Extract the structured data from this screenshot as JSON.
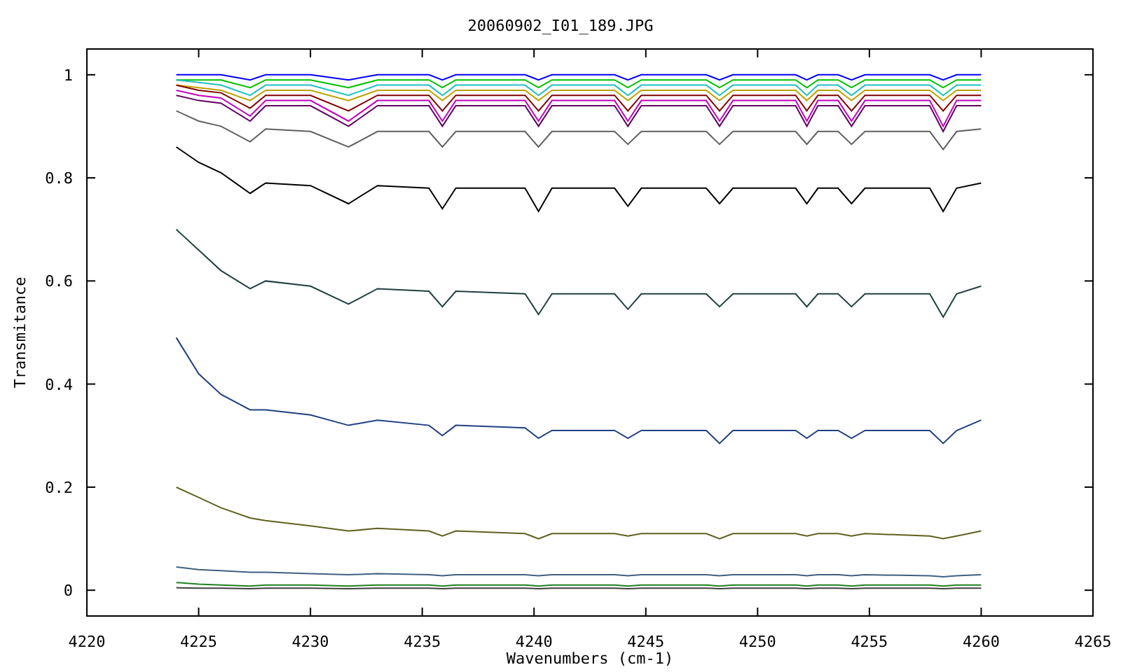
{
  "chart": {
    "chart_data": {
      "type": "line",
      "title": "20060902_I01_189.JPG",
      "xlabel": "Wavenumbers (cm-1)",
      "ylabel": "Transmitance",
      "xlim": [
        4220,
        4265
      ],
      "ylim": [
        -0.05,
        1.05
      ],
      "xticks": [
        4220,
        4225,
        4230,
        4235,
        4240,
        4245,
        4250,
        4255,
        4260,
        4265
      ],
      "yticks": [
        {
          "value": 0,
          "label": "0"
        },
        {
          "value": 0.2,
          "label": "0.2"
        },
        {
          "value": 0.4,
          "label": "0.4"
        },
        {
          "value": 0.6,
          "label": "0.6"
        },
        {
          "value": 0.8,
          "label": "0.8"
        },
        {
          "value": 1,
          "label": "1"
        }
      ],
      "x": [
        4224,
        4225,
        4226,
        4227.3,
        4228,
        4230,
        4231.7,
        4233,
        4235.3,
        4235.9,
        4236.5,
        4239.6,
        4240.2,
        4240.8,
        4243.6,
        4244.2,
        4244.8,
        4247.7,
        4248.3,
        4248.9,
        4251.7,
        4252.2,
        4252.7,
        4253.6,
        4254.2,
        4254.8,
        4257.7,
        4258.3,
        4258.9,
        4260
      ],
      "series": [
        {
          "color": "#0000ff",
          "values": [
            1,
            1,
            1,
            0.99,
            1,
            1,
            0.99,
            1,
            1,
            0.99,
            1,
            1,
            0.99,
            1,
            1,
            0.99,
            1,
            1,
            0.99,
            1,
            1,
            0.99,
            1,
            1,
            0.99,
            1,
            1,
            0.99,
            1,
            1
          ]
        },
        {
          "color": "#00c000",
          "values": [
            0.99,
            0.99,
            0.99,
            0.975,
            0.99,
            0.99,
            0.975,
            0.99,
            0.99,
            0.975,
            0.99,
            0.99,
            0.975,
            0.99,
            0.99,
            0.975,
            0.99,
            0.99,
            0.975,
            0.99,
            0.99,
            0.975,
            0.99,
            0.99,
            0.975,
            0.99,
            0.99,
            0.975,
            0.99,
            0.99
          ]
        },
        {
          "color": "#20c0c0",
          "values": [
            0.99,
            0.985,
            0.98,
            0.96,
            0.98,
            0.98,
            0.96,
            0.98,
            0.98,
            0.96,
            0.98,
            0.98,
            0.96,
            0.98,
            0.98,
            0.96,
            0.98,
            0.98,
            0.96,
            0.98,
            0.98,
            0.96,
            0.98,
            0.98,
            0.96,
            0.98,
            0.98,
            0.96,
            0.98,
            0.98
          ]
        },
        {
          "color": "#c0a000",
          "values": [
            0.98,
            0.975,
            0.97,
            0.95,
            0.97,
            0.97,
            0.95,
            0.97,
            0.97,
            0.95,
            0.97,
            0.97,
            0.95,
            0.97,
            0.97,
            0.95,
            0.97,
            0.97,
            0.95,
            0.97,
            0.97,
            0.95,
            0.97,
            0.97,
            0.95,
            0.97,
            0.97,
            0.95,
            0.97,
            0.97
          ]
        },
        {
          "color": "#800000",
          "values": [
            0.98,
            0.97,
            0.965,
            0.935,
            0.96,
            0.96,
            0.93,
            0.96,
            0.96,
            0.93,
            0.96,
            0.96,
            0.93,
            0.96,
            0.96,
            0.93,
            0.96,
            0.96,
            0.93,
            0.96,
            0.96,
            0.93,
            0.96,
            0.96,
            0.93,
            0.96,
            0.96,
            0.93,
            0.96,
            0.96
          ]
        },
        {
          "color": "#c000c0",
          "values": [
            0.97,
            0.96,
            0.955,
            0.92,
            0.95,
            0.95,
            0.91,
            0.95,
            0.95,
            0.91,
            0.95,
            0.95,
            0.91,
            0.95,
            0.95,
            0.91,
            0.95,
            0.95,
            0.91,
            0.95,
            0.95,
            0.91,
            0.95,
            0.95,
            0.91,
            0.95,
            0.95,
            0.9,
            0.95,
            0.95
          ]
        },
        {
          "color": "#600060",
          "values": [
            0.96,
            0.95,
            0.945,
            0.91,
            0.94,
            0.94,
            0.9,
            0.94,
            0.94,
            0.9,
            0.94,
            0.94,
            0.9,
            0.94,
            0.94,
            0.9,
            0.94,
            0.94,
            0.9,
            0.94,
            0.94,
            0.9,
            0.94,
            0.94,
            0.9,
            0.94,
            0.94,
            0.89,
            0.94,
            0.94
          ]
        },
        {
          "color": "#606060",
          "values": [
            0.93,
            0.91,
            0.9,
            0.87,
            0.895,
            0.89,
            0.86,
            0.89,
            0.89,
            0.86,
            0.89,
            0.89,
            0.86,
            0.89,
            0.89,
            0.865,
            0.89,
            0.89,
            0.865,
            0.89,
            0.89,
            0.865,
            0.89,
            0.89,
            0.865,
            0.89,
            0.89,
            0.855,
            0.89,
            0.895
          ]
        },
        {
          "color": "#000000",
          "values": [
            0.86,
            0.83,
            0.81,
            0.77,
            0.79,
            0.785,
            0.75,
            0.785,
            0.78,
            0.74,
            0.78,
            0.78,
            0.735,
            0.78,
            0.78,
            0.745,
            0.78,
            0.78,
            0.75,
            0.78,
            0.78,
            0.75,
            0.78,
            0.78,
            0.75,
            0.78,
            0.78,
            0.735,
            0.78,
            0.79
          ]
        },
        {
          "color": "#204040",
          "values": [
            0.7,
            0.66,
            0.62,
            0.585,
            0.6,
            0.59,
            0.555,
            0.585,
            0.58,
            0.55,
            0.58,
            0.575,
            0.535,
            0.575,
            0.575,
            0.545,
            0.575,
            0.575,
            0.55,
            0.575,
            0.575,
            0.55,
            0.575,
            0.575,
            0.55,
            0.575,
            0.575,
            0.53,
            0.575,
            0.59
          ]
        },
        {
          "color": "#204080",
          "values": [
            0.49,
            0.42,
            0.38,
            0.35,
            0.35,
            0.34,
            0.32,
            0.33,
            0.32,
            0.3,
            0.32,
            0.315,
            0.295,
            0.31,
            0.31,
            0.295,
            0.31,
            0.31,
            0.285,
            0.31,
            0.31,
            0.295,
            0.31,
            0.31,
            0.295,
            0.31,
            0.31,
            0.285,
            0.31,
            0.33
          ]
        },
        {
          "color": "#606020",
          "values": [
            0.2,
            0.18,
            0.16,
            0.14,
            0.135,
            0.125,
            0.115,
            0.12,
            0.115,
            0.105,
            0.115,
            0.11,
            0.1,
            0.11,
            0.11,
            0.105,
            0.11,
            0.11,
            0.1,
            0.11,
            0.11,
            0.105,
            0.11,
            0.11,
            0.105,
            0.11,
            0.105,
            0.1,
            0.105,
            0.115
          ]
        },
        {
          "color": "#406080",
          "values": [
            0.045,
            0.04,
            0.038,
            0.035,
            0.035,
            0.032,
            0.03,
            0.032,
            0.03,
            0.028,
            0.03,
            0.03,
            0.028,
            0.03,
            0.03,
            0.028,
            0.03,
            0.03,
            0.028,
            0.03,
            0.03,
            0.028,
            0.03,
            0.03,
            0.028,
            0.03,
            0.028,
            0.026,
            0.028,
            0.03
          ]
        },
        {
          "color": "#208020",
          "values": [
            0.015,
            0.012,
            0.01,
            0.008,
            0.01,
            0.01,
            0.008,
            0.01,
            0.01,
            0.008,
            0.01,
            0.01,
            0.008,
            0.01,
            0.01,
            0.008,
            0.01,
            0.01,
            0.008,
            0.01,
            0.01,
            0.008,
            0.01,
            0.01,
            0.008,
            0.01,
            0.01,
            0.008,
            0.01,
            0.01
          ]
        },
        {
          "color": "#404040",
          "values": [
            0.005,
            0.004,
            0.004,
            0.003,
            0.004,
            0.004,
            0.003,
            0.004,
            0.004,
            0.003,
            0.004,
            0.004,
            0.003,
            0.004,
            0.004,
            0.003,
            0.004,
            0.004,
            0.003,
            0.004,
            0.004,
            0.003,
            0.004,
            0.004,
            0.003,
            0.004,
            0.004,
            0.003,
            0.004,
            0.004
          ]
        }
      ]
    }
  }
}
